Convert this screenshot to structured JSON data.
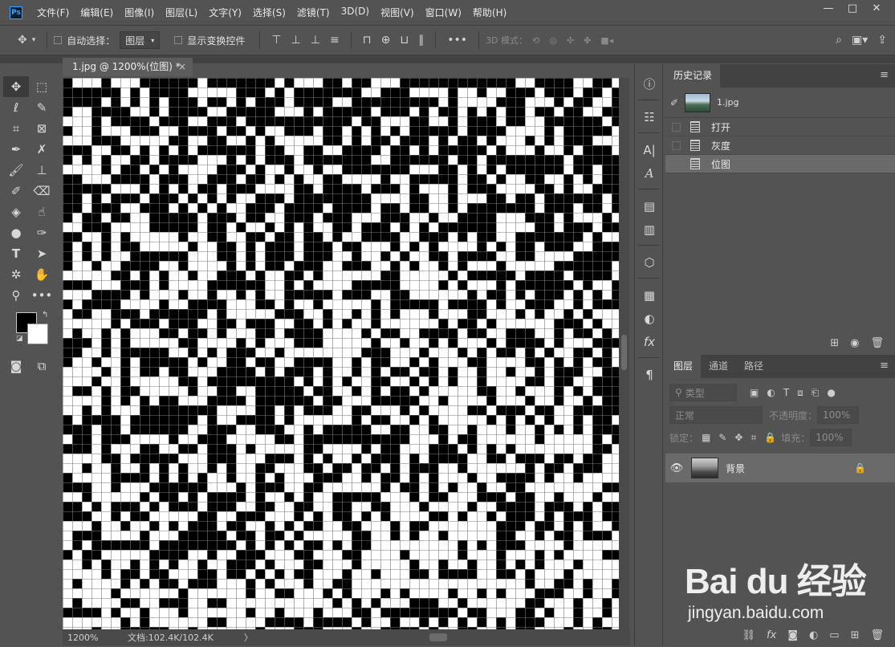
{
  "app": {
    "logo_text": "Ps"
  },
  "menubar": {
    "items": [
      "文件(F)",
      "编辑(E)",
      "图像(I)",
      "图层(L)",
      "文字(Y)",
      "选择(S)",
      "滤镜(T)",
      "3D(D)",
      "视图(V)",
      "窗口(W)",
      "帮助(H)"
    ]
  },
  "window_controls": {
    "minimize": "—",
    "maximize": "□",
    "close": "✕"
  },
  "options_bar": {
    "auto_select_label": "自动选择：",
    "auto_select_value": "图层",
    "show_transform_label": "显示变换控件",
    "mode_3d_label": "3D 模式："
  },
  "document_tab": {
    "title": "1.jpg @ 1200%(位图) *",
    "close": "×"
  },
  "status_bar": {
    "zoom": "1200%",
    "doc_info": "文档:102.4K/102.4K",
    "arrow": "〉"
  },
  "history_panel": {
    "tab": "历史记录",
    "snapshot_name": "1.jpg",
    "items": [
      {
        "label": "打开",
        "active": false
      },
      {
        "label": "灰度",
        "active": false
      },
      {
        "label": "位图",
        "active": true
      }
    ]
  },
  "layers_panel": {
    "tabs": [
      "图层",
      "通道",
      "路径"
    ],
    "filter_kind": "类型",
    "blend_mode": "正常",
    "opacity_label": "不透明度：",
    "opacity_value": "100%",
    "lock_label": "锁定：",
    "fill_label": "填充：",
    "fill_value": "100%",
    "layers": [
      {
        "name": "背景",
        "visible": true,
        "locked": true
      }
    ]
  },
  "canvas": {
    "pattern": "bitmap-dither",
    "colors": [
      "#000000",
      "#ffffff"
    ],
    "grid_color": "#7a7a7a"
  },
  "watermark": {
    "logo": "Bai du 经验",
    "url": "jingyan.baidu.com"
  }
}
